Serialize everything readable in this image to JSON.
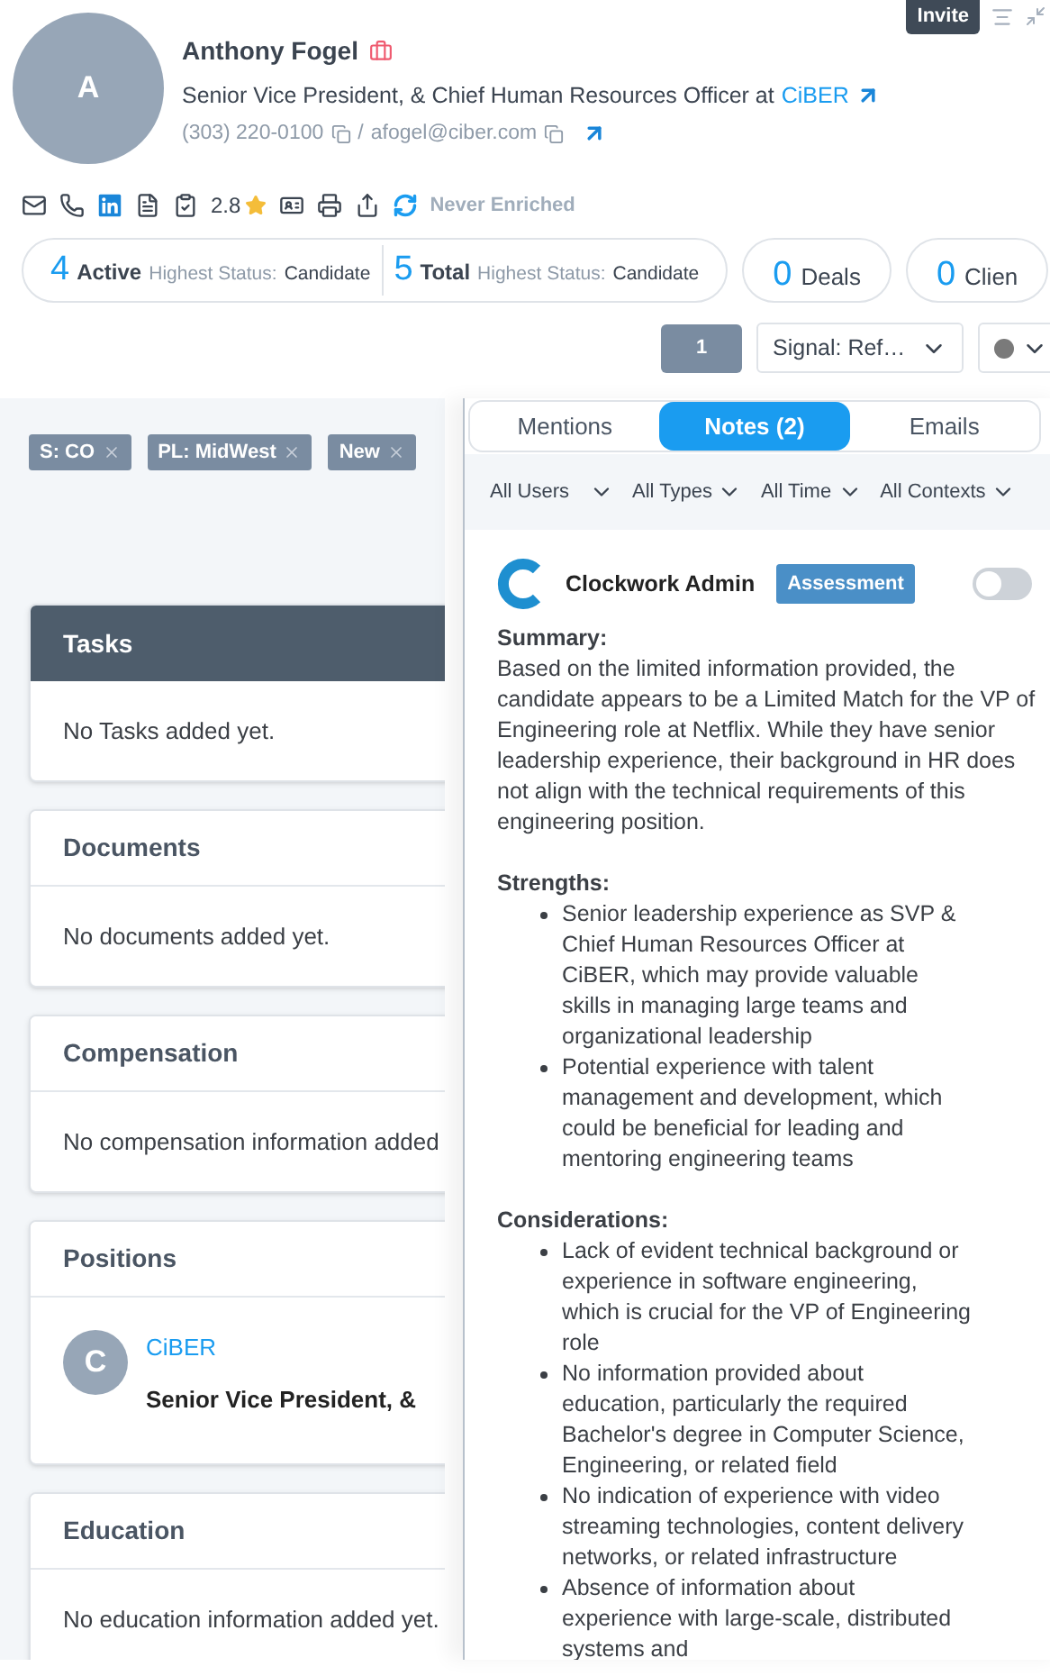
{
  "header": {
    "invite": "Invite",
    "avatar_initial": "A",
    "name": "Anthony Fogel",
    "title_prefix": "Senior Vice President, & Chief Human Resources Officer at",
    "company": "CiBER",
    "phone": "(303) 220-0100",
    "separator": "/",
    "email": "afogel@ciber.com",
    "rating": "2.8",
    "enrichment": "Never Enriched"
  },
  "stats": [
    {
      "count": "4",
      "label": "Active",
      "status_label": "Highest Status:",
      "status": "Candidate"
    },
    {
      "count": "5",
      "label": "Total",
      "status_label": "Highest Status:",
      "status": "Candidate"
    }
  ],
  "counters": [
    {
      "count": "0",
      "label": "Deals"
    },
    {
      "count": "0",
      "label": "Clien"
    }
  ],
  "controls": {
    "page": "1",
    "signal": "Signal: Ref…"
  },
  "tags": [
    "S: CO",
    "PL: MidWest",
    "New"
  ],
  "cards": [
    {
      "kind": "empty",
      "title": "Tasks",
      "highlighted": true,
      "text": "No Tasks added yet."
    },
    {
      "kind": "empty",
      "title": "Documents",
      "highlighted": false,
      "text": "No documents added yet."
    },
    {
      "kind": "empty",
      "title": "Compensation",
      "highlighted": false,
      "text": "No compensation information added"
    },
    {
      "kind": "position",
      "title": "Positions",
      "highlighted": false,
      "initial": "C",
      "company": "CiBER",
      "role": "Senior Vice President, &"
    },
    {
      "kind": "empty",
      "title": "Education",
      "highlighted": false,
      "text": "No education information added yet."
    }
  ],
  "panel": {
    "tabs": [
      {
        "label": "Mentions",
        "selected": false
      },
      {
        "label": "Notes (2)",
        "selected": true
      },
      {
        "label": "Emails",
        "selected": false
      }
    ],
    "filters": [
      "All Users",
      "All Types",
      "All Time",
      "All Contexts"
    ],
    "note": {
      "author": "Clockwork Admin",
      "badge": "Assessment",
      "on": false,
      "sections": [
        {
          "heading": "Summary:",
          "paragraph": "Based on the limited information provided, the candidate appears to be a Limited Match for the VP of Engineering role at Netflix. While they have senior leadership experience, their background in HR does not align with the technical requirements of this engineering position."
        },
        {
          "heading": "Strengths:",
          "bullets": [
            "Senior leadership experience as SVP & Chief Human Resources Officer at CiBER, which may provide valuable skills in managing large teams and organizational leadership",
            "Potential experience with talent management and development, which could be beneficial for leading and mentoring engineering teams"
          ]
        },
        {
          "heading": "Considerations:",
          "bullets": [
            "Lack of evident technical background or experience in software engineering, which is crucial for the VP of Engineering role",
            "No information provided about education, particularly the required Bachelor's degree in Computer Science, Engineering, or related field",
            "No indication of experience with video streaming technologies, content delivery networks, or related infrastructure",
            "Absence of information about experience with large-scale, distributed systems and"
          ]
        }
      ]
    }
  }
}
